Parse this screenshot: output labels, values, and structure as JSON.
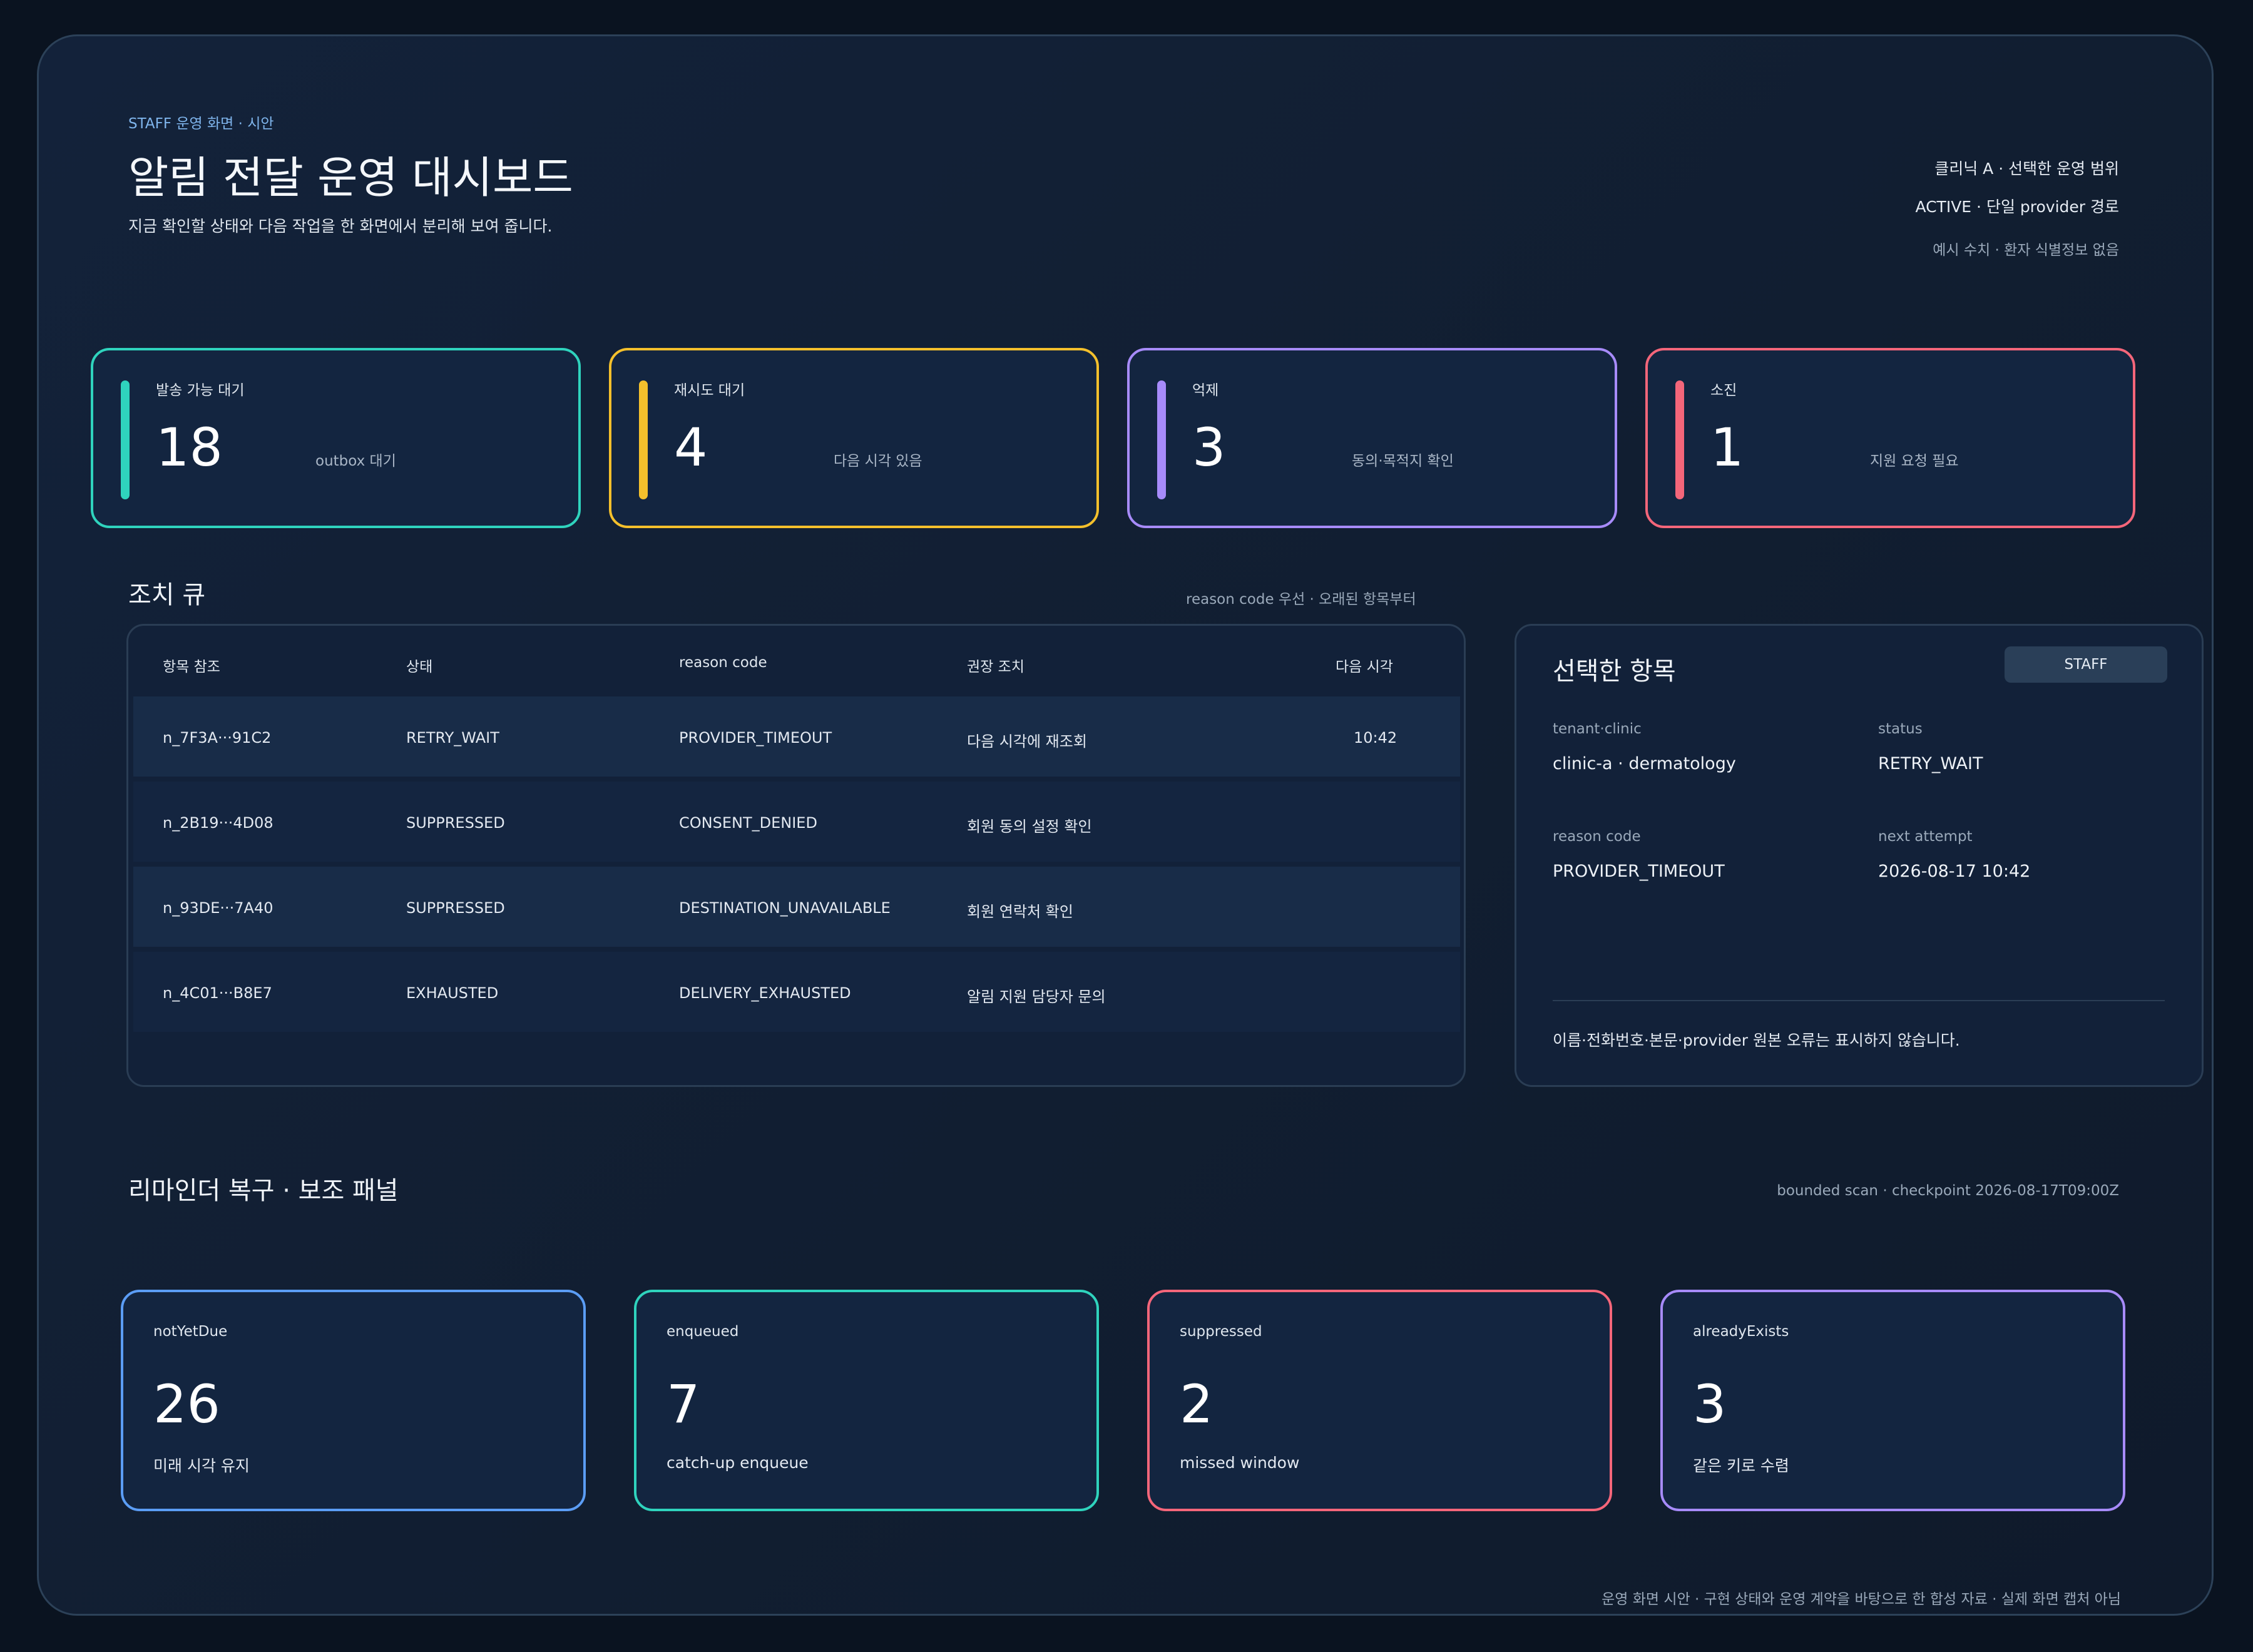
{
  "header": {
    "eyebrow": "STAFF 운영 화면 · 시안",
    "title": "알림 전달 운영 대시보드",
    "subtitle": "지금 확인할 상태와 다음 작업을 한 화면에서 분리해 보여 줍니다.",
    "scope": "클리닉 A · 선택한 운영 범위",
    "mode": "ACTIVE · 단일 provider 경로",
    "note": "예시 수치 · 환자 식별정보 없음"
  },
  "kpis": [
    {
      "label": "발송 가능 대기",
      "value": "18",
      "hint": "outbox 대기",
      "color": "#2fd3bd"
    },
    {
      "label": "재시도 대기",
      "value": "4",
      "hint": "다음 시각 있음",
      "color": "#f4c02c"
    },
    {
      "label": "억제",
      "value": "3",
      "hint": "동의·목적지 확인",
      "color": "#a78bfa"
    },
    {
      "label": "소진",
      "value": "1",
      "hint": "지원 요청 필요",
      "color": "#f4667a"
    }
  ],
  "queue": {
    "title": "조치 큐",
    "note": "reason code 우선 · 오래된 항목부터",
    "columns": [
      "항목 참조",
      "상태",
      "reason code",
      "권장 조치",
      "다음 시각"
    ],
    "rows": [
      {
        "ref": "n_7F3A···91C2",
        "status": "RETRY_WAIT",
        "reason": "PROVIDER_TIMEOUT",
        "action": "다음 시각에 재조회",
        "next": "10:42"
      },
      {
        "ref": "n_2B19···4D08",
        "status": "SUPPRESSED",
        "reason": "CONSENT_DENIED",
        "action": "회원 동의 설정 확인",
        "next": ""
      },
      {
        "ref": "n_93DE···7A40",
        "status": "SUPPRESSED",
        "reason": "DESTINATION_UNAVAILABLE",
        "action": "회원 연락처 확인",
        "next": ""
      },
      {
        "ref": "n_4C01···B8E7",
        "status": "EXHAUSTED",
        "reason": "DELIVERY_EXHAUSTED",
        "action": "알림 지원 담당자 문의",
        "next": ""
      }
    ]
  },
  "detail": {
    "title": "선택한 항목",
    "badge": "STAFF",
    "fields": [
      {
        "label": "tenant·clinic",
        "value": "clinic-a · dermatology"
      },
      {
        "label": "status",
        "value": "RETRY_WAIT"
      },
      {
        "label": "reason code",
        "value": "PROVIDER_TIMEOUT"
      },
      {
        "label": "next attempt",
        "value": "2026-08-17 10:42"
      }
    ],
    "privacy_note": "이름·전화번호·본문·provider 원본 오류는 표시하지 않습니다."
  },
  "recovery": {
    "title": "리마인더 복구 · 보조 패널",
    "note": "bounded scan · checkpoint 2026-08-17T09:00Z",
    "cards": [
      {
        "label": "notYetDue",
        "value": "26",
        "hint": "미래 시각 유지",
        "color": "#5b9df5"
      },
      {
        "label": "enqueued",
        "value": "7",
        "hint": "catch-up enqueue",
        "color": "#2fd3bd"
      },
      {
        "label": "suppressed",
        "value": "2",
        "hint": "missed window",
        "color": "#f4667a"
      },
      {
        "label": "alreadyExists",
        "value": "3",
        "hint": "같은 키로 수렴",
        "color": "#a78bfa"
      }
    ]
  },
  "footer": "운영 화면 시안 · 구현 상태와 운영 계약을 바탕으로 한 합성 자료 · 실제 화면 캡처 아님"
}
